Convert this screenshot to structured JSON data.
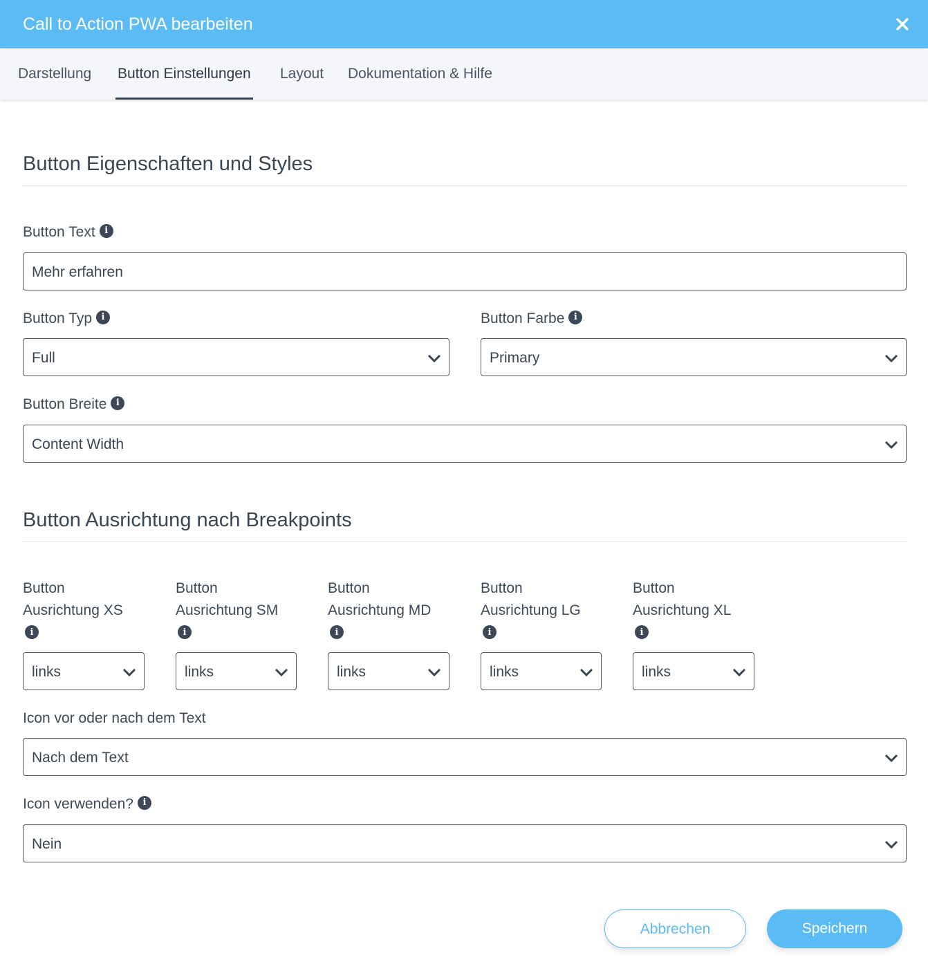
{
  "modal": {
    "title": "Call to Action PWA bearbeiten"
  },
  "tabs": [
    {
      "label": "Darstellung",
      "active": false
    },
    {
      "label": "Button Einstellungen",
      "active": true
    },
    {
      "label": "Layout",
      "active": false
    },
    {
      "label": "Dokumentation & Hilfe",
      "active": false
    }
  ],
  "sections": {
    "properties": "Button Eigenschaften und Styles",
    "alignment": "Button Ausrichtung nach Breakpoints"
  },
  "fields": {
    "button_text": {
      "label": "Button Text",
      "value": "Mehr erfahren"
    },
    "button_typ": {
      "label": "Button Typ",
      "value": "Full"
    },
    "button_farbe": {
      "label": "Button Farbe",
      "value": "Primary"
    },
    "button_breite": {
      "label": "Button Breite",
      "value": "Content Width"
    },
    "align_xs": {
      "label_line1": "Button",
      "label_line2": "Ausrichtung XS",
      "value": "links"
    },
    "align_sm": {
      "label_line1": "Button",
      "label_line2": "Ausrichtung SM",
      "value": "links"
    },
    "align_md": {
      "label_line1": "Button",
      "label_line2": "Ausrichtung MD",
      "value": "links"
    },
    "align_lg": {
      "label_line1": "Button",
      "label_line2": "Ausrichtung LG",
      "value": "links"
    },
    "align_xl": {
      "label_line1": "Button",
      "label_line2": "Ausrichtung XL",
      "value": "links"
    },
    "icon_position": {
      "label": "Icon vor oder nach dem Text",
      "value": "Nach dem Text"
    },
    "icon_use": {
      "label": "Icon verwenden?",
      "value": "Nein"
    }
  },
  "actions": {
    "cancel": "Abbrechen",
    "save": "Speichern"
  },
  "colors": {
    "accent": "#5bbcf5",
    "text": "#3f4a58",
    "tabbar": "#f5f6f9"
  },
  "icons": {
    "close": "close-icon",
    "info": "info-icon",
    "dropdown": "chevron-down-icon"
  }
}
